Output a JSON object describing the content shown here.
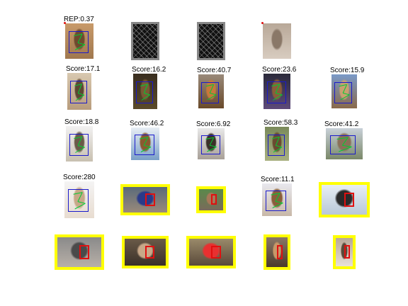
{
  "figure": {
    "rows": [
      [
        {
          "kind": "horse",
          "label": "REP:0.37",
          "colors": [
            "#c89a6a",
            "#6e4a2e",
            "#a0784e"
          ]
        },
        {
          "kind": "hog",
          "label": "",
          "colors": []
        },
        {
          "kind": "hog",
          "label": "",
          "colors": []
        },
        {
          "kind": "horse-plain",
          "label": "",
          "colors": [
            "#b8a898",
            "#8a7868",
            "#d8ccc0"
          ]
        },
        {
          "kind": "empty",
          "label": "",
          "colors": []
        }
      ],
      [
        {
          "kind": "horse",
          "label": "Score:17.1",
          "colors": [
            "#d8c8b0",
            "#5e4632",
            "#b89c7c"
          ]
        },
        {
          "kind": "horse",
          "label": "Score:16.2",
          "colors": [
            "#3a2e20",
            "#7a5a34",
            "#5a4a2a"
          ]
        },
        {
          "kind": "horse",
          "label": "Score:40.7",
          "colors": [
            "#9a8a7a",
            "#c8783a",
            "#6a4a2a"
          ]
        },
        {
          "kind": "horse",
          "label": "Score:23.6",
          "colors": [
            "#2a2a3a",
            "#8a5e3a",
            "#5e4a7a"
          ]
        },
        {
          "kind": "horse",
          "label": "Score:15.9",
          "colors": [
            "#7a9ac8",
            "#c8a070",
            "#8a6a4a"
          ]
        }
      ],
      [
        {
          "kind": "horse",
          "label": "Score:18.8",
          "colors": [
            "#f2f2f2",
            "#6a5a48",
            "#c8c0b0"
          ]
        },
        {
          "kind": "horse",
          "label": "Score:46.2",
          "colors": [
            "#e8eef4",
            "#8a5a30",
            "#7aa0c8"
          ]
        },
        {
          "kind": "horse",
          "label": "Score:6.92",
          "colors": [
            "#e8e8e8",
            "#3a3028",
            "#a8a098"
          ]
        },
        {
          "kind": "horse",
          "label": "Score:58.3",
          "colors": [
            "#7a8a5a",
            "#6a4a30",
            "#a8b080"
          ]
        },
        {
          "kind": "horse",
          "label": "Score:41.2",
          "colors": [
            "#c8d0d8",
            "#8a7058",
            "#7a8868"
          ]
        }
      ],
      [
        {
          "kind": "horse",
          "label": "Score:280",
          "colors": [
            "#f4f4f4",
            "#c8a888",
            "#e8dcd0"
          ]
        },
        {
          "kind": "yellow",
          "label": "",
          "colors": [
            "#5a6a7a",
            "#2a3a8a",
            "#9a8a7a"
          ]
        },
        {
          "kind": "yellow",
          "label": "",
          "colors": [
            "#5a8a4a",
            "#a87858",
            "#7a6a5a"
          ]
        },
        {
          "kind": "horse",
          "label": "Score:11.1",
          "colors": [
            "#e8e8ee",
            "#8a5e3a",
            "#c8b8a8"
          ]
        },
        {
          "kind": "yellow",
          "label": "",
          "colors": [
            "#e8eef4",
            "#2a2a2a",
            "#b8c8d8"
          ]
        }
      ],
      [
        {
          "kind": "yellow",
          "label": "",
          "colors": [
            "#8a8a8a",
            "#4a4a4a",
            "#b8b0a8"
          ]
        },
        {
          "kind": "yellow",
          "label": "",
          "colors": [
            "#6a5a48",
            "#c8a888",
            "#3a3028"
          ]
        },
        {
          "kind": "yellow",
          "label": "",
          "colors": [
            "#9a8a6a",
            "#e83030",
            "#5a4a3a"
          ]
        },
        {
          "kind": "yellow",
          "label": "",
          "colors": [
            "#8a7868",
            "#c89868",
            "#4a3a2a"
          ]
        },
        {
          "kind": "yellow",
          "label": "",
          "colors": [
            "#b8a898",
            "#5a4a3a",
            "#e8e0d8"
          ]
        }
      ]
    ]
  },
  "colors": {
    "detection_box": "#1a1acc",
    "part_box": "#e01010",
    "false_positive_frame": "#ffff00",
    "part_lines": "#00cc33"
  }
}
